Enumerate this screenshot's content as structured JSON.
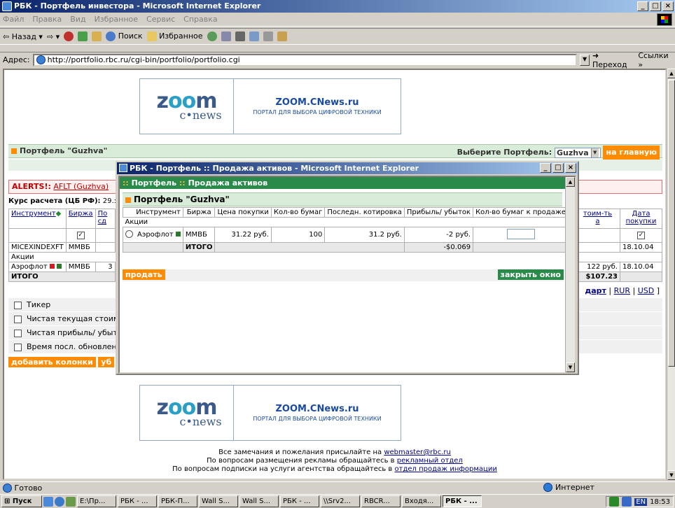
{
  "window": {
    "title": "РБК - Портфель инвестора - Microsoft Internet Explorer",
    "min": "_",
    "max": "□",
    "close": "×"
  },
  "menu": [
    "Файл",
    "Правка",
    "Вид",
    "Избранное",
    "Сервис",
    "Справка"
  ],
  "toolbar": {
    "back": "Назад",
    "search": "Поиск",
    "favorites": "Избранное"
  },
  "address": {
    "label": "Адрес:",
    "url": "http://portfolio.rbc.ru/cgi-bin/portfolio/portfolio.cgi",
    "go": "Переход",
    "links": "Ссылки"
  },
  "banner": {
    "logo_z": "z",
    "logo_oo": "oo",
    "logo_m": "m",
    "logo_cnews": "c•news",
    "title": "ZOOM.CNews.ru",
    "subtitle": "ПОРТАЛ ДЛЯ ВЫБОРА ЦИФРОВОЙ ТЕХНИКИ"
  },
  "portfolio": {
    "title": "Портфель \"Guzhva\"",
    "choose": "Выберите Портфель:",
    "selected": "Guzhva",
    "home": "на главную"
  },
  "alerts": {
    "label": "ALERTS!:",
    "link": "AFLT (Guzhva)"
  },
  "rate": {
    "label": "Курс расчета (ЦБ РФ):",
    "value": "29.:"
  },
  "main_table": {
    "h_instr": "Инструмент",
    "h_exch": "Биржа",
    "h_cut": "По",
    "h_cut2": "сд",
    "h_cost": "тоим-ть",
    "h_cost2": "а",
    "h_date": "Дата",
    "h_date2": "покупки",
    "r1_name": "MICEXINDEXFT",
    "r1_exch": "ММВБ",
    "r1_date": "18.10.04",
    "section": "Акции",
    "r2_name": "Аэрофлот",
    "r2_exch": "ММВБ",
    "r2_cut": "3",
    "r2_cost": "122 руб.",
    "r2_date": "18.10.04",
    "total": "ИТОГО",
    "total_val": "$107.23"
  },
  "currency": {
    "chart": "дарт",
    "rur": "RUR",
    "usd": "USD",
    "sep": "|",
    "br": "]"
  },
  "columns": [
    "Тикер",
    "Чистая текущая стоим",
    "Чистая прибыль/ убыт",
    "Время посл. обновлен"
  ],
  "buttons": {
    "add_cols": "добавить колонки",
    "remove_cut": "уб"
  },
  "footer": {
    "l1": "Все замечания и пожелания присылайте на",
    "l1_link": "webmaster@rbc.ru",
    "l2": "По вопросам размещения рекламы обращайтесь в",
    "l2_link": "рекламный отдел",
    "l3": "По вопросам подписки на услуги агентства обращайтесь в",
    "l3_link": "отдел продаж информации"
  },
  "popup": {
    "title": "РБК - Портфель :: Продажа активов - Microsoft Internet Explorer",
    "header_pre": "::",
    "header_a": "Портфель",
    "header_b": "Продажа активов",
    "portfolio": "Портфель \"Guzhva\"",
    "cols": [
      "Инструмент",
      "Биржа",
      "Цена покупки",
      "Кол-во бумаг",
      "Последн. котировка",
      "Прибыль/ убыток",
      "Кол-во бумаг к продаже"
    ],
    "section": "Акции",
    "row": {
      "name": "Аэрофлот",
      "exch": "ММВБ",
      "price": "31.22 руб.",
      "qty": "100",
      "last": "31.2 руб.",
      "pnl": "-2 руб."
    },
    "total": "ИТОГО",
    "total_pnl": "-$0.069",
    "sell": "продать",
    "close": "закрыть окно"
  },
  "status": {
    "ready": "Готово",
    "zone": "Интернет"
  },
  "taskbar": {
    "start": "Пуск",
    "items": [
      "E:\\Пр...",
      "РБК - ...",
      "РБК-П...",
      "Wall S...",
      "Wall S...",
      "РБК - ...",
      "\\\\Srv2...",
      "RBCR...",
      "Входя...",
      "РБК - ..."
    ],
    "lang": "EN",
    "time": "18:53"
  }
}
